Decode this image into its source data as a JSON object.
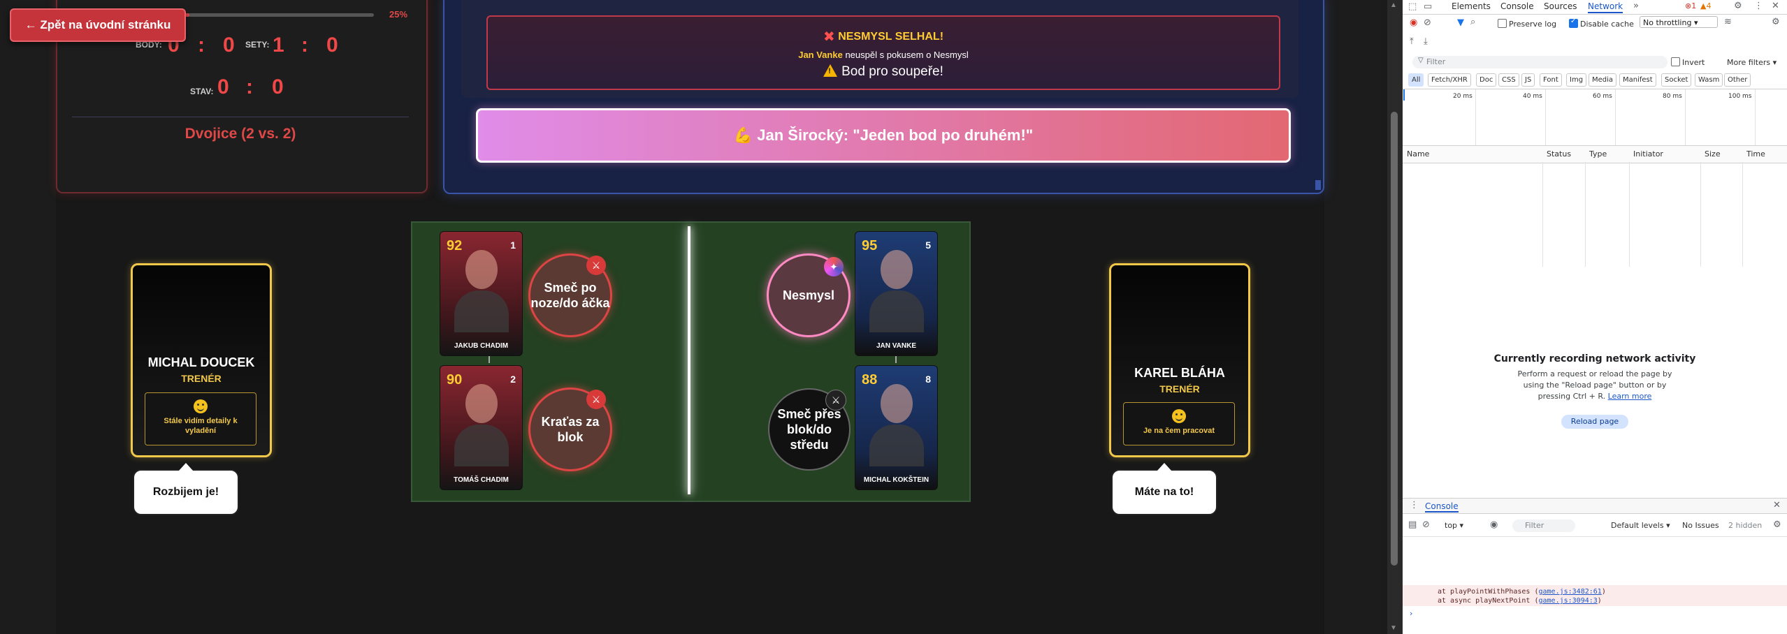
{
  "game": {
    "back_button": "← Zpět na úvodní stránku",
    "progress_percent": "25%",
    "progress_value": 0.25,
    "score": {
      "body_label": "BODY:",
      "body_left": "0",
      "body_right": "0",
      "sety_label": "SETY:",
      "sety_left": "1",
      "sety_right": "0",
      "stav_label": "STAV:",
      "stav_left": "0",
      "stav_right": "0",
      "separator": ":"
    },
    "mode": "Dvojice (2 vs. 2)",
    "event": {
      "fail_title": "NESMYSL SELHAL!",
      "fail_player": "Jan Vanke",
      "fail_text": "neuspěl s pokusem o Nesmysl",
      "point_text": "Bod pro soupeře!",
      "quote": "💪 Jan Širocký: \"Jeden bod po druhém!\""
    },
    "players": [
      {
        "rating": "92",
        "number": "1",
        "name": "JAKUB CHADIM",
        "team": "red"
      },
      {
        "rating": "90",
        "number": "2",
        "name": "TOMÁŠ CHADIM",
        "team": "red"
      },
      {
        "rating": "95",
        "number": "5",
        "name": "JAN VANKE",
        "team": "blue"
      },
      {
        "rating": "88",
        "number": "8",
        "name": "MICHAL KOKŠTEIN",
        "team": "blue"
      }
    ],
    "actions": [
      {
        "label": "Smeč po noze/do áčka",
        "badge": "⚔"
      },
      {
        "label": "Kraťas za blok",
        "badge": "⚔"
      },
      {
        "label": "Nesmysl",
        "badge": "✦"
      },
      {
        "label": "Smeč přes blok/do středu",
        "badge": "⚔"
      }
    ],
    "coaches": [
      {
        "name": "MICHAL DOUCEK",
        "role": "TRENÉR",
        "mood": "Stále vidím detaily k vyladění",
        "speech": "Rozbijem je!"
      },
      {
        "name": "KAREL BLÁHA",
        "role": "TRENÉR",
        "mood": "Je na čem pracovat",
        "speech": "Máte na to!"
      }
    ],
    "colors": {
      "accent_red": "#e04848",
      "accent_gold": "#f2c84b",
      "court_green": "#244122"
    }
  },
  "devtools": {
    "tabs": [
      "Elements",
      "Console",
      "Sources",
      "Network"
    ],
    "active_tab": "Network",
    "error_count": "1",
    "warning_count": "4",
    "preserve_log": "Preserve log",
    "disable_cache": "Disable cache",
    "throttling": "No throttling",
    "filter_placeholder": "Filter",
    "invert": "Invert",
    "more_filters": "More filters ▾",
    "type_filters": [
      "All",
      "Fetch/XHR",
      "Doc",
      "CSS",
      "JS",
      "Font",
      "Img",
      "Media",
      "Manifest",
      "Socket",
      "Wasm",
      "Other"
    ],
    "timeline_ticks": [
      "20 ms",
      "40 ms",
      "60 ms",
      "80 ms",
      "100 ms"
    ],
    "columns": [
      "Name",
      "Status",
      "Type",
      "Initiator",
      "Size",
      "Time"
    ],
    "empty_title": "Currently recording network activity",
    "empty_text": "Perform a request or reload the page by using the \"Reload page\" button or by pressing Ctrl + R.",
    "learn_more": "Learn more",
    "reload_button": "Reload page",
    "console_tab": "Console",
    "console_context": "top ▾",
    "console_filter": "Filter",
    "default_levels": "Default levels ▾",
    "no_issues": "No Issues",
    "hidden": "2 hidden",
    "stack": [
      {
        "text": "at playPointWithPhases (",
        "file": "game.js:3482:61",
        "close": ")"
      },
      {
        "text": "at async playNextPoint (",
        "file": "game.js:3094:3",
        "close": ")"
      }
    ],
    "prompt": "›"
  }
}
